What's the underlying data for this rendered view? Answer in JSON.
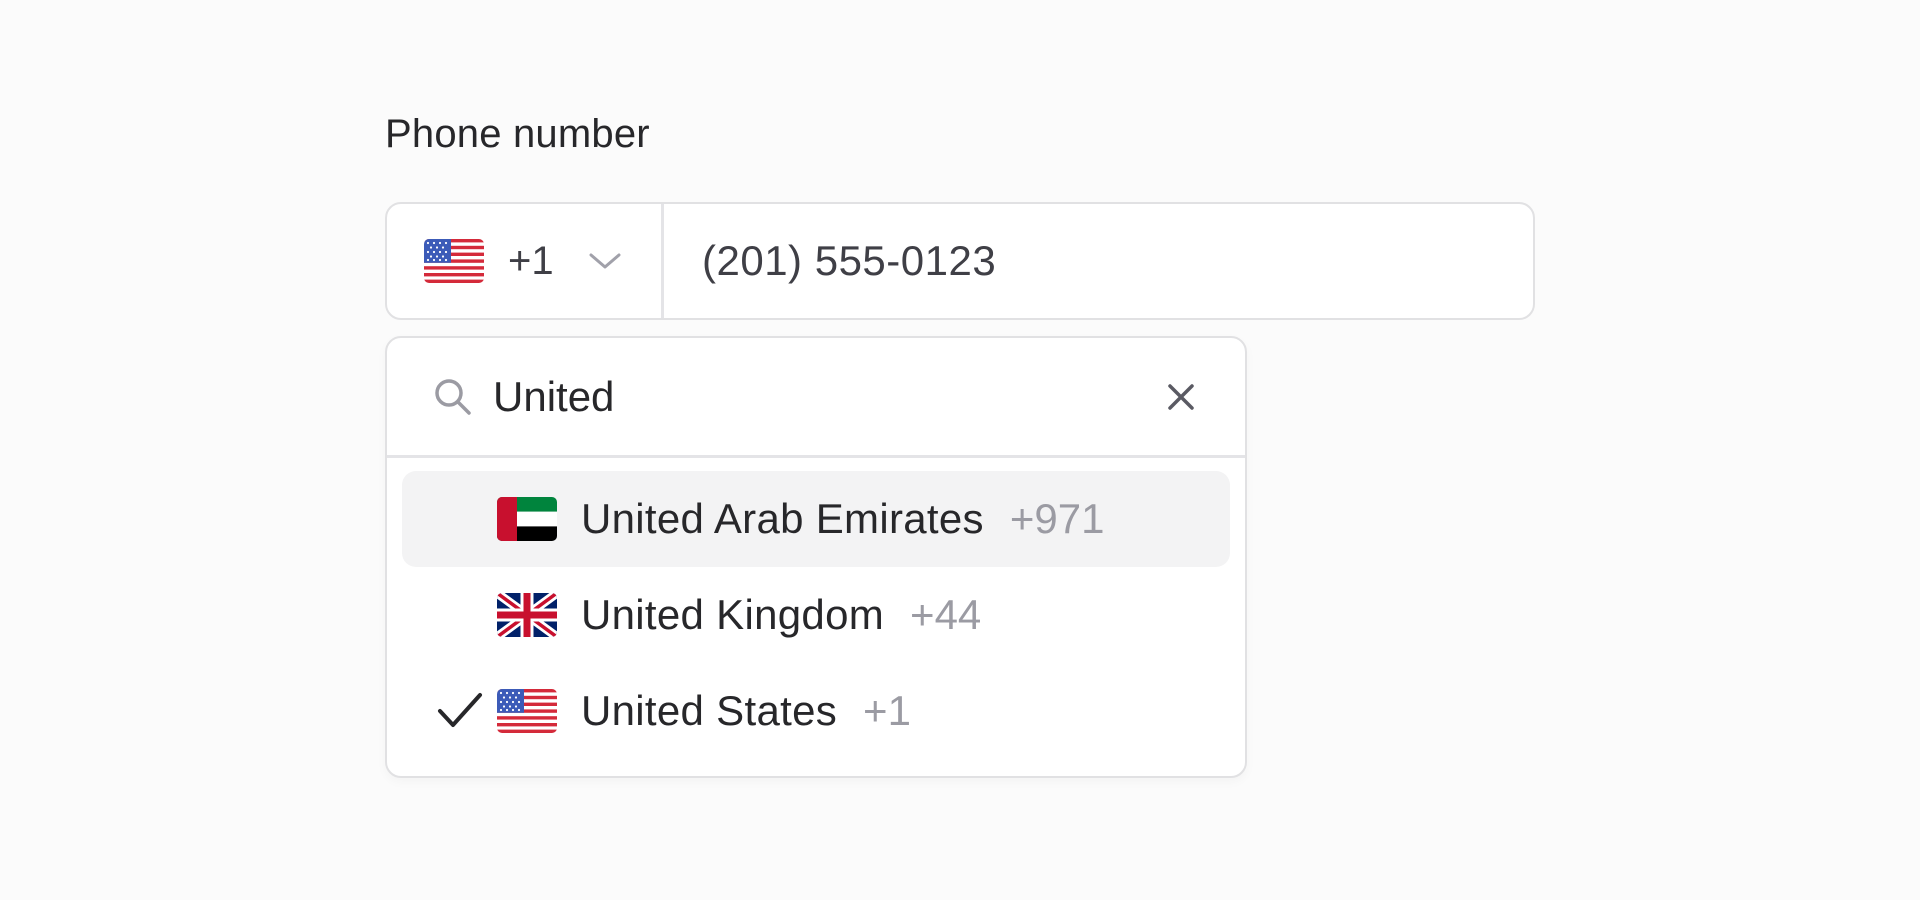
{
  "field": {
    "label": "Phone number"
  },
  "country_select": {
    "selected_flag": "US",
    "selected_dial_code": "+1",
    "chevron_icon": "chevron-down-icon"
  },
  "phone_input": {
    "value": "(201) 555-0123"
  },
  "dropdown": {
    "search_icon": "search-icon",
    "search_value": "United",
    "clear_icon": "close-icon",
    "options": [
      {
        "flag": "AE",
        "name": "United Arab Emirates",
        "dial_code": "+971",
        "highlighted": true,
        "selected": false
      },
      {
        "flag": "GB",
        "name": "United Kingdom",
        "dial_code": "+44",
        "highlighted": false,
        "selected": false
      },
      {
        "flag": "US",
        "name": "United States",
        "dial_code": "+1",
        "highlighted": false,
        "selected": true
      }
    ]
  },
  "colors": {
    "text": "#27272a",
    "muted": "#9b9ba3",
    "border": "#e1e1e3",
    "highlight_bg": "#f3f3f4"
  }
}
